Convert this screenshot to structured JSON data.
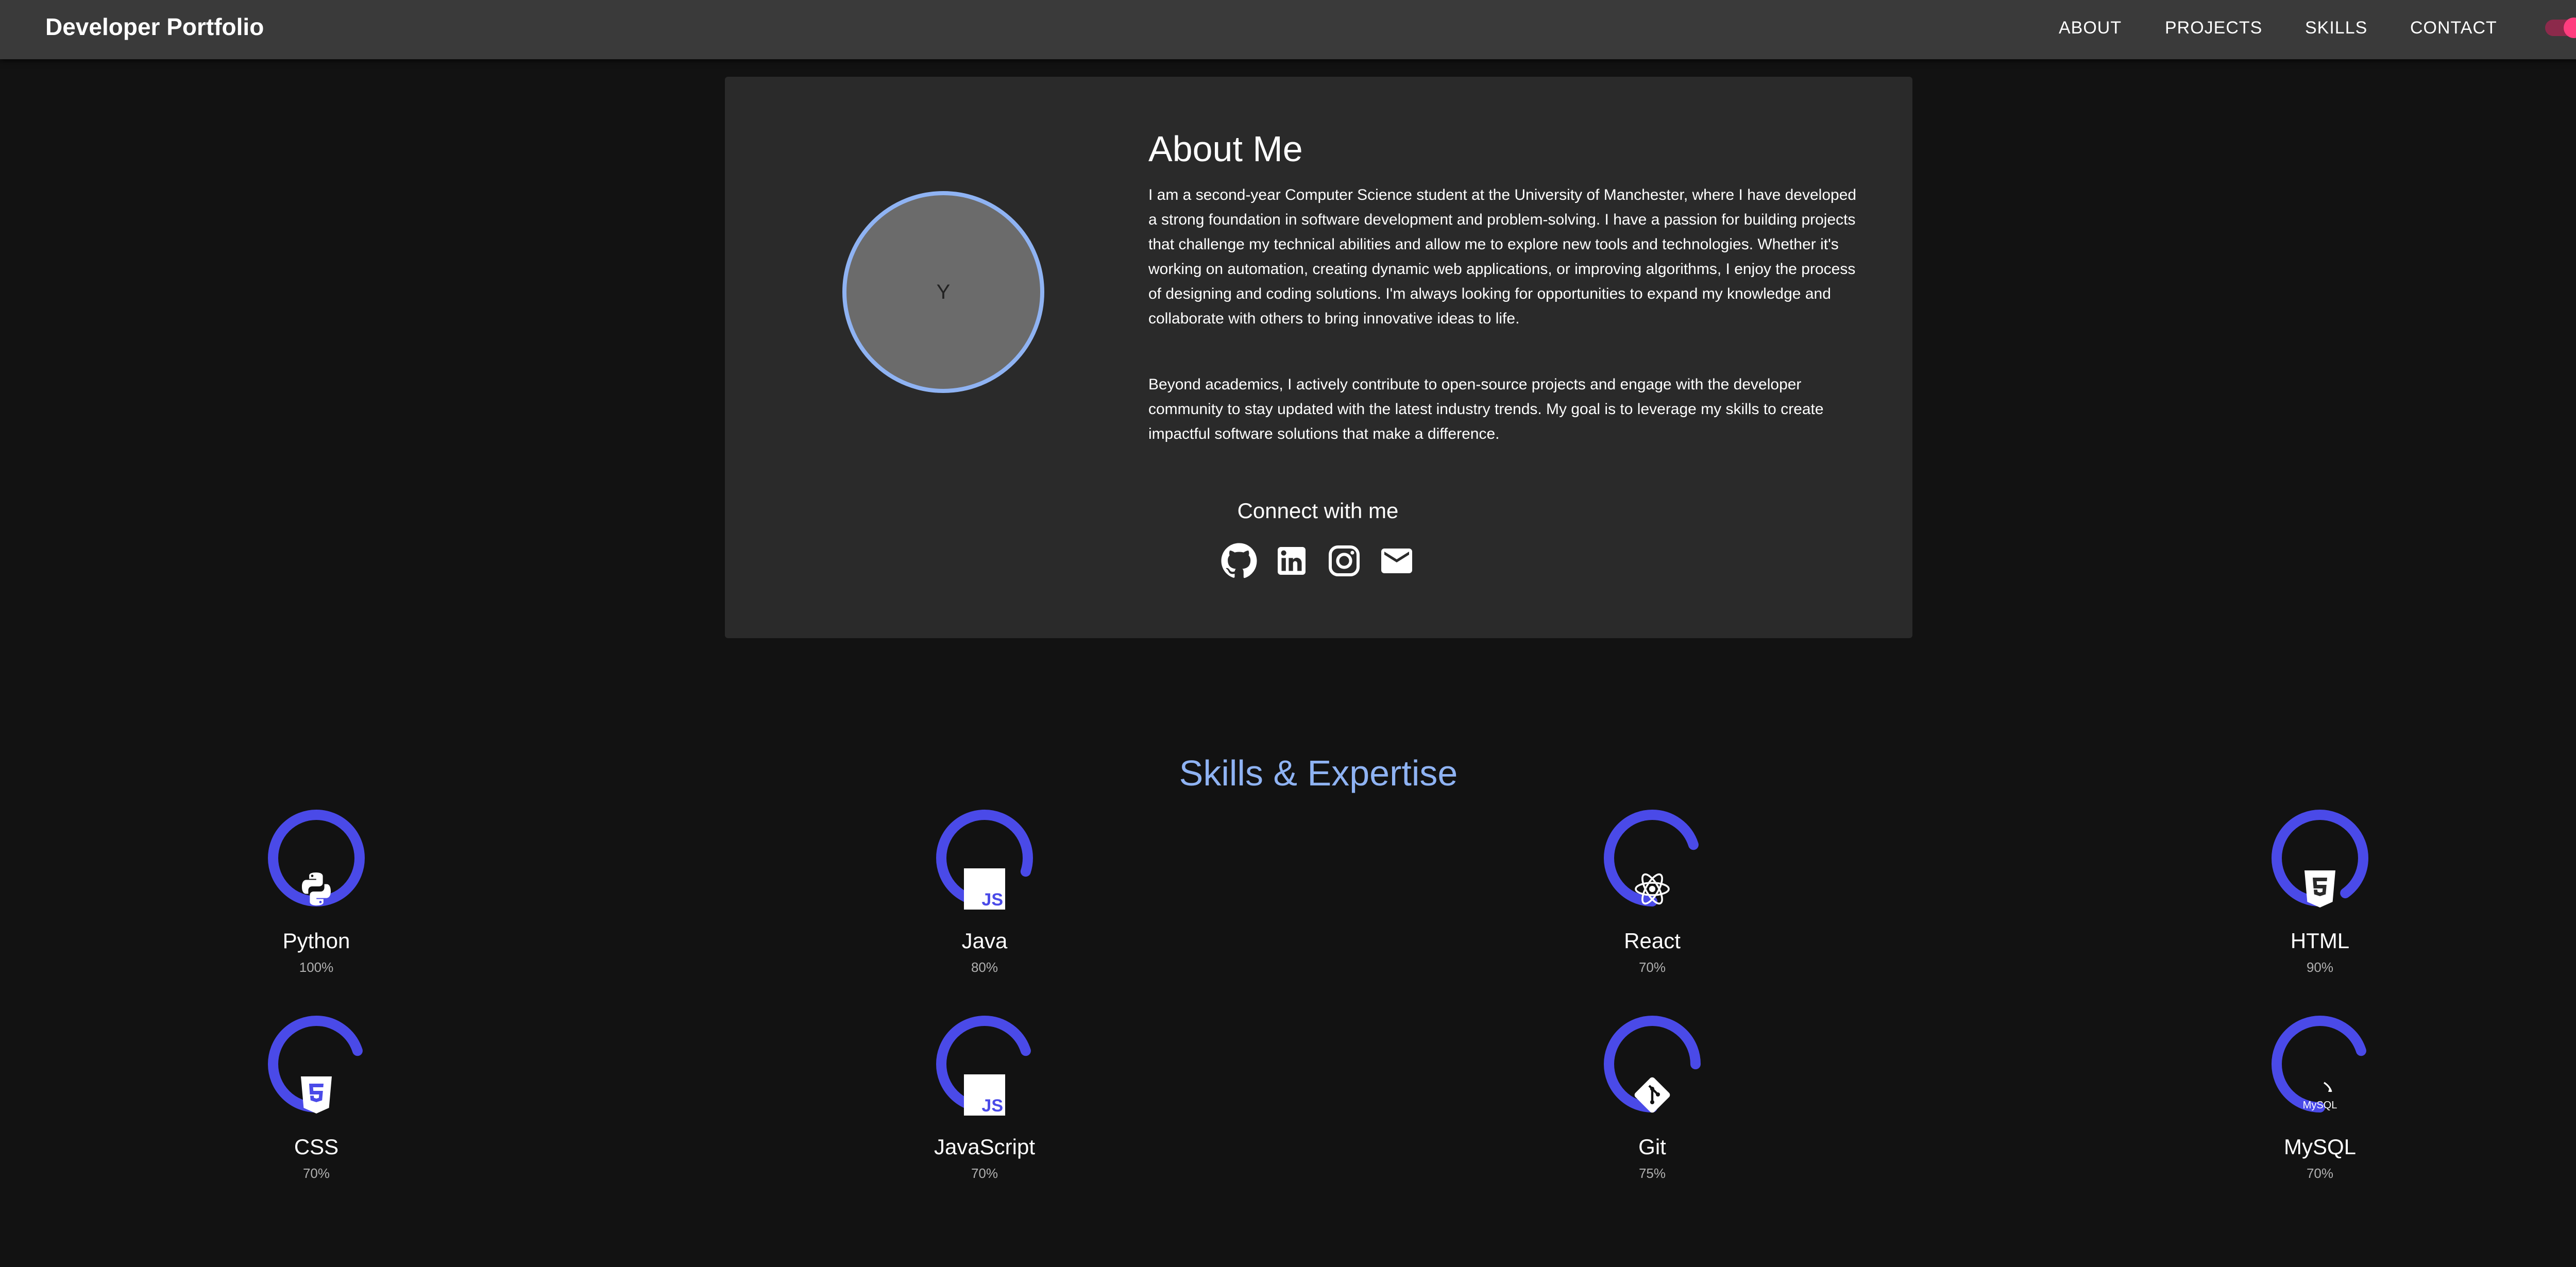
{
  "navbar": {
    "brand": "Developer Portfolio",
    "links": [
      "ABOUT",
      "PROJECTS",
      "SKILLS",
      "CONTACT"
    ],
    "theme_toggle_on": true,
    "accent": "#ff3d7f"
  },
  "about": {
    "title": "About Me",
    "avatar_initial": "Y",
    "paragraph_1": "I am a second-year Computer Science student at the University of Manchester, where I have developed a strong foundation in software development and problem-solving. I have a passion for building projects that challenge my technical abilities and allow me to explore new tools and technologies. Whether it's working on automation, creating dynamic web applications, or improving algorithms, I enjoy the process of designing and coding solutions. I'm always looking for opportunities to expand my knowledge and collaborate with others to bring innovative ideas to life.",
    "paragraph_2": "Beyond academics, I actively contribute to open-source projects and engage with the developer community to stay updated with the latest industry trends. My goal is to leverage my skills to create impactful software solutions that make a difference.",
    "connect_title": "Connect with me",
    "social_icons": [
      "github-icon",
      "linkedin-icon",
      "instagram-icon",
      "email-icon"
    ]
  },
  "skills": {
    "title": "Skills & Expertise",
    "ring_color": "#4a4ae8",
    "items": [
      {
        "name": "Python",
        "percent_label": "100%",
        "level": 100,
        "icon": "python-icon"
      },
      {
        "name": "Java",
        "percent_label": "80%",
        "level": 80,
        "icon": "js-icon"
      },
      {
        "name": "React",
        "percent_label": "70%",
        "level": 70,
        "icon": "react-icon"
      },
      {
        "name": "HTML",
        "percent_label": "90%",
        "level": 90,
        "icon": "html5-icon"
      },
      {
        "name": "CSS",
        "percent_label": "70%",
        "level": 70,
        "icon": "css3-icon"
      },
      {
        "name": "JavaScript",
        "percent_label": "70%",
        "level": 70,
        "icon": "js-icon"
      },
      {
        "name": "Git",
        "percent_label": "75%",
        "level": 75,
        "icon": "git-icon"
      },
      {
        "name": "MySQL",
        "percent_label": "70%",
        "level": 70,
        "icon": "mysql-icon"
      }
    ]
  }
}
